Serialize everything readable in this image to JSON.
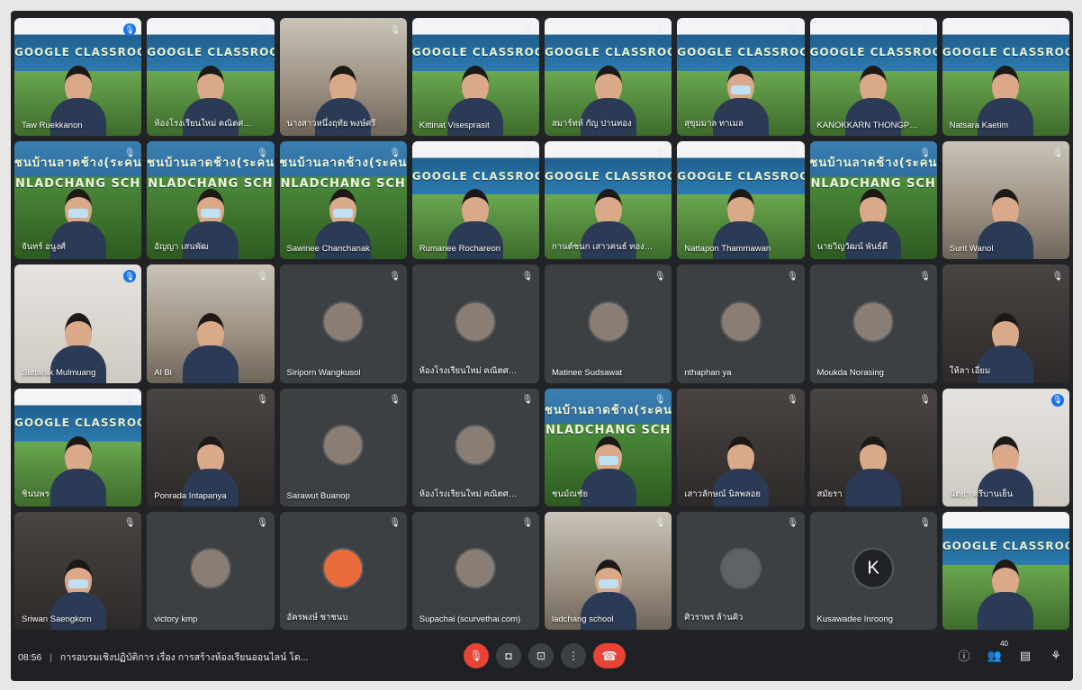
{
  "meeting": {
    "time": "08:56",
    "title": "การอบรมเชิงปฏิบัติการ เรื่อง การสร้างห้องเรียนออนไลน์ โด..."
  },
  "participant_count": "40",
  "banner_texts": {
    "classroom": "GOOGLE CLASSROOM",
    "school_top": "ชนบ้านลาดช้าง(ระคนกิจ",
    "school_bottom": "NLADCHANG SCH"
  },
  "tiles": [
    {
      "name": "Taw Ruekkanon",
      "type": "video",
      "bg": "classroom",
      "mic": "blue"
    },
    {
      "name": "ห้องโรงเรียนใหม่ คณิตศาสตร์ อ...",
      "type": "video",
      "bg": "classroom",
      "mic": "off"
    },
    {
      "name": "นางสาวหนึ่งฤทัย พงษ์ศรี",
      "type": "video",
      "bg": "room",
      "mic": "off"
    },
    {
      "name": "Kittinat Visesprasit",
      "type": "video",
      "bg": "classroom",
      "mic": "off"
    },
    {
      "name": "สมาร์ทห์ กัญ ปานทอง",
      "type": "video",
      "bg": "classroom",
      "mic": "off"
    },
    {
      "name": "สุขุมมาล ทาเมล",
      "type": "video",
      "bg": "classroom",
      "mic": "off",
      "mask": true
    },
    {
      "name": "KANOKKARN THONGPRAD...",
      "type": "video",
      "bg": "classroom",
      "mic": "off"
    },
    {
      "name": "Natsara Kaetim",
      "type": "video",
      "bg": "classroom",
      "mic": "off"
    },
    {
      "name": "จันทร์ อนูงศ์",
      "type": "video",
      "bg": "school",
      "mic": "off",
      "mask": true
    },
    {
      "name": "อัญญา เสนพัฒ",
      "type": "video",
      "bg": "school",
      "mic": "off",
      "mask": true
    },
    {
      "name": "Sawinee Chanchanak",
      "type": "video",
      "bg": "school",
      "mic": "off",
      "mask": true
    },
    {
      "name": "Rumanee Rochareon",
      "type": "video",
      "bg": "classroom",
      "mic": "off"
    },
    {
      "name": "กานต์ชนก เสาวคนธ์ ทองพวง",
      "type": "video",
      "bg": "classroom",
      "mic": "off"
    },
    {
      "name": "Nattapon Thammawan",
      "type": "video",
      "bg": "classroom",
      "mic": "off"
    },
    {
      "name": "นายวิญวัฒน์ พันธ์ดี",
      "type": "video",
      "bg": "school",
      "mic": "off"
    },
    {
      "name": "Surit Wanol",
      "type": "video",
      "bg": "room",
      "mic": "off"
    },
    {
      "name": "Suttarak Mulmuang",
      "type": "video",
      "bg": "light",
      "mic": "blue"
    },
    {
      "name": "Al Bi",
      "type": "video",
      "bg": "room",
      "mic": "off"
    },
    {
      "name": "Siriporn Wangkusol",
      "type": "avatar",
      "avatar": "",
      "mic": "off"
    },
    {
      "name": "ห้องโรงเรียนใหม่ คณิตศาสตร์ ม...",
      "type": "avatar",
      "avatar": "",
      "mic": "off"
    },
    {
      "name": "Matinee Sudsawat",
      "type": "avatar",
      "avatar": "",
      "mic": "off"
    },
    {
      "name": "nthaphan ya",
      "type": "avatar",
      "avatar": "",
      "mic": "off"
    },
    {
      "name": "Moukda Norasing",
      "type": "avatar",
      "avatar": "",
      "mic": "off"
    },
    {
      "name": "ให้ลา เอี่ยม",
      "type": "video",
      "bg": "dark",
      "mic": "off"
    },
    {
      "name": "ชินนพร",
      "type": "video",
      "bg": "classroom",
      "mic": "off"
    },
    {
      "name": "Ponrada Intapanya",
      "type": "video",
      "bg": "dark",
      "mic": "off"
    },
    {
      "name": "Sarawut Buanop",
      "type": "avatar",
      "avatar": "",
      "mic": "off"
    },
    {
      "name": "ห้องโรงเรียนใหม่ คณิตศาสตร์ อ...",
      "type": "avatar",
      "avatar": "",
      "mic": "off"
    },
    {
      "name": "ชนม์ณชัย",
      "type": "video",
      "bg": "school",
      "mic": "off",
      "mask": true
    },
    {
      "name": "เสาวลักษณ์ นิลพลอย",
      "type": "video",
      "bg": "dark",
      "mic": "off"
    },
    {
      "name": "สมัยรา",
      "type": "video",
      "bg": "dark",
      "mic": "off"
    },
    {
      "name": "นิตยา ศรีบานเย็น",
      "type": "video",
      "bg": "light",
      "mic": "blue"
    },
    {
      "name": "Sriwan Saengkorn",
      "type": "video",
      "bg": "dark",
      "mic": "off",
      "mask": true
    },
    {
      "name": "victory kmp",
      "type": "avatar",
      "avatar": "",
      "mic": "off"
    },
    {
      "name": "อัครพงษ์ ชาชนบ",
      "type": "avatar",
      "avatar": "",
      "avatar_style": "orange",
      "mic": "off"
    },
    {
      "name": "Supachai (scurvethai.com)",
      "type": "avatar",
      "avatar": "",
      "mic": "off"
    },
    {
      "name": "ladchang school",
      "type": "video",
      "bg": "room",
      "mic": "off",
      "mask": true
    },
    {
      "name": "ศิวราพร ล้านคิว",
      "type": "avatar",
      "avatar": "",
      "avatar_style": "grey",
      "mic": "off"
    },
    {
      "name": "Kusawadee Inroong",
      "type": "avatar",
      "avatar": "K",
      "avatar_style": "dark",
      "mic": "off"
    },
    {
      "name": "",
      "type": "video",
      "bg": "classroom",
      "mic": "none"
    }
  ],
  "icons": {
    "mic_off": "🎙",
    "camera": "◘",
    "present": "⊡",
    "more": "⋮",
    "hangup": "☎",
    "info": "ⓘ",
    "people": "👥",
    "chat": "▤",
    "activities": "⚘"
  }
}
